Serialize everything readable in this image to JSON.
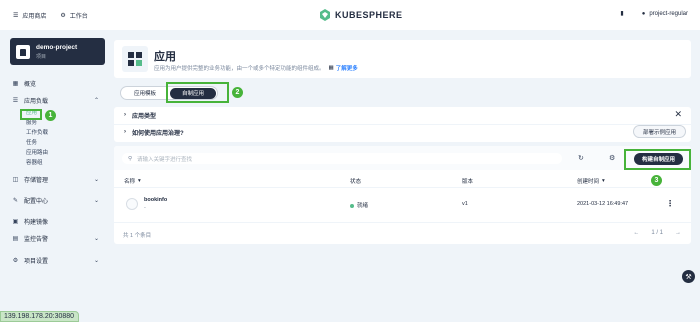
{
  "topbar": {
    "app_store": "应用商店",
    "workbench": "工作台",
    "brand": "KUBESPHERE",
    "user": "project-regular"
  },
  "project": {
    "name": "demo-project",
    "type": "项目"
  },
  "sidebar": {
    "overview": "概览",
    "app_workloads": "应用负载",
    "sub": [
      "应用",
      "服务",
      "工作负载",
      "任务",
      "应用路由",
      "容器组"
    ],
    "storage": "存储管理",
    "config": "配置中心",
    "build_image": "构建镜像",
    "monitoring": "监控告警",
    "settings": "项目设置"
  },
  "header": {
    "title": "应用",
    "description": "应用为用户提供完整的业务功能，由一个或多个特定功能的组件组成。",
    "learn_more": "了解更多"
  },
  "tabs": [
    "应用模板",
    "自制应用"
  ],
  "info": {
    "app_types": "应用类型",
    "governance": "如何使用应用治理?",
    "demo_button": "部署示例应用"
  },
  "table": {
    "search_placeholder": "请输入关键字进行查找",
    "create_button": "构建自制应用",
    "columns": [
      "名称",
      "状态",
      "版本",
      "创建时间"
    ],
    "rows": [
      {
        "name": "bookinfo",
        "sub": "-",
        "status": "就绪",
        "version": "v1",
        "created": "2021-03-12 16:49:47"
      }
    ],
    "total": "共 1 个条目",
    "page": "1 / 1"
  },
  "annotations": [
    "1",
    "2",
    "3"
  ],
  "status_bar": "139.198.178.20:30880",
  "colors": {
    "accent_green": "#47b33a",
    "dark": "#242e42",
    "ready": "#55bc8a"
  }
}
